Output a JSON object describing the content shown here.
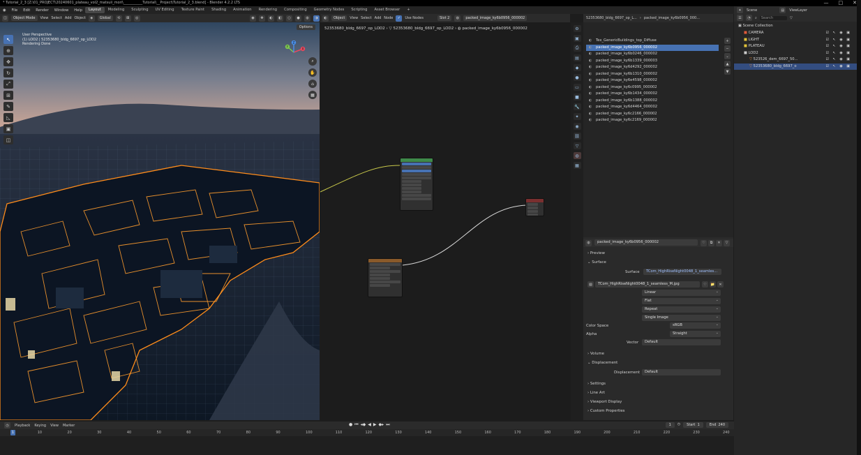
{
  "window": {
    "title": "* Tutorial_2_3 [Z:\\01_PROJECT\\20240601_plateau_vol2_matsuii_mori\\___________Tutorial\\__Project\\Tutorial_2_3.blend] - Blender 4.2.2 LTS",
    "controls": [
      "—",
      "□",
      "✕"
    ]
  },
  "menu": {
    "items": [
      "File",
      "Edit",
      "Render",
      "Window",
      "Help"
    ],
    "workspaces": [
      "Layout",
      "Modeling",
      "Sculpting",
      "UV Editing",
      "Texture Paint",
      "Shading",
      "Animation",
      "Rendering",
      "Compositing",
      "Geometry Nodes",
      "Scripting",
      "Asset Browser",
      "+"
    ],
    "active_workspace": "Layout"
  },
  "viewport": {
    "mode": "Object Mode",
    "menus": [
      "View",
      "Select",
      "Add",
      "Object"
    ],
    "orientation": "Global",
    "options_label": "Options",
    "overlay_lines": [
      "User Perspective",
      "(1) LOD2 | 52353680_bldg_6697_op_LOD2",
      "Rendering Done"
    ],
    "gizmo_axes": [
      "X",
      "Y",
      "Z"
    ]
  },
  "node_editor": {
    "object_label": "Object",
    "menus": [
      "View",
      "Select",
      "Add",
      "Node"
    ],
    "use_nodes_label": "Use Nodes",
    "slot_label": "Slot 2",
    "material_name": "packed_image_ky6b0956_000002",
    "breadcrumb": [
      "52353680_bldg_6697_op_LOD2",
      "52353680_bldg_6697_op_LOD2",
      "packed_image_ky6b0956_000002"
    ]
  },
  "image_browser": {
    "header_path": [
      "52353680_bldg_6697_op_L...",
      "packed_image_ky6b0956_000..."
    ],
    "items": [
      "Tex_GenericBuildings_top_Diffuse",
      "packed_image_ky6b0956_000002",
      "packed_image_ky6b0246_000002",
      "packed_image_ky6b1339_000003",
      "packed_image_ky6d4292_000002",
      "packed_image_ky6b1310_000002",
      "packed_image_ky6e4598_000002",
      "packed_image_ky6c0995_000002",
      "packed_image_ky6b1434_000002",
      "packed_image_ky6b1388_000002",
      "packed_image_ky6d4464_000002",
      "packed_image_ky6c2166_000002",
      "packed_image_ky6c2169_000002"
    ],
    "selected_index": 1
  },
  "material_props": {
    "material_field": "packed_image_ky6b0956_000002",
    "sections": {
      "preview": "Preview",
      "surface": "Surface",
      "volume": "Volume",
      "displacement": "Displacement",
      "settings": "Settings",
      "line_art": "Line Art",
      "viewport_display": "Viewport Display",
      "custom_properties": "Custom Properties"
    },
    "surface_label": "Surface",
    "surface_value": "TCom_HighRiseNight0048_1_seamles...",
    "image_name": "TCom_HighRiseNight0048_1_seamless_M.jpg",
    "interpolation": "Linear",
    "projection": "Flat",
    "extension": "Repeat",
    "source": "Single Image",
    "color_space_label": "Color Space",
    "color_space": "sRGB",
    "alpha_label": "Alpha",
    "alpha": "Straight",
    "vector_label": "Vector",
    "vector_value": "Default",
    "displacement_label": "Displacement",
    "displacement_value": "Default"
  },
  "outliner": {
    "scene": "Scene",
    "view_layer": "ViewLayer",
    "search_placeholder": "Search",
    "root": "Scene Collection",
    "rows": [
      {
        "label": "CAMERA",
        "indent": 1,
        "color": "#e05a3a"
      },
      {
        "label": "LIGHT",
        "indent": 1,
        "color": "#e0c23a"
      },
      {
        "label": "PLATEAU",
        "indent": 1,
        "color": "#e0c23a"
      },
      {
        "label": "LOD2",
        "indent": 1,
        "color": "#cccccc"
      },
      {
        "label": "523526_dem_6697_50...",
        "indent": 2,
        "color": "#e08a3a"
      },
      {
        "label": "52353680_bldg_6697_o",
        "indent": 2,
        "color": "#e08a3a",
        "selected": true
      }
    ]
  },
  "timeline": {
    "menus": [
      "Playback",
      "Keying",
      "View",
      "Marker"
    ],
    "current_frame": "1",
    "start_label": "Start",
    "start": "1",
    "end_label": "End",
    "end": "240",
    "ticks": [
      "1",
      "10",
      "20",
      "30",
      "40",
      "50",
      "60",
      "70",
      "80",
      "90",
      "100",
      "110",
      "120",
      "130",
      "140",
      "150",
      "160",
      "170",
      "180",
      "190",
      "200",
      "210",
      "220",
      "230",
      "240"
    ]
  },
  "colors": {
    "accent": "#4772b3",
    "outline_orange": "#ff8c1a",
    "sky_top": "#2f4660",
    "sky_horizon": "#c9a596"
  }
}
